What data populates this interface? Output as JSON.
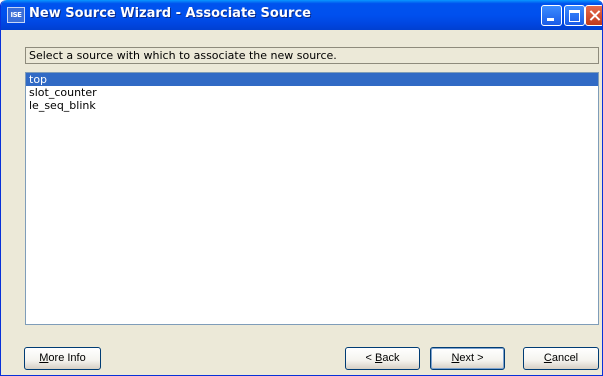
{
  "window": {
    "title": "New Source Wizard - Associate Source",
    "icon_label": "ISE"
  },
  "prompt": "Select a source with which to associate the new source.",
  "sources": [
    {
      "label": "top",
      "selected": true
    },
    {
      "label": "slot_counter",
      "selected": false
    },
    {
      "label": "le_seq_blink",
      "selected": false
    }
  ],
  "buttons": {
    "more_info": {
      "mnemonic": "M",
      "rest": "ore Info"
    },
    "back": {
      "prefix": "< ",
      "mnemonic": "B",
      "rest": "ack"
    },
    "next": {
      "mnemonic": "N",
      "rest": "ext >"
    },
    "cancel": {
      "mnemonic": "C",
      "rest": "ancel"
    }
  },
  "colors": {
    "titlebar": "#0050ee",
    "selection": "#316ac5",
    "dialog_bg": "#ece9d8"
  }
}
